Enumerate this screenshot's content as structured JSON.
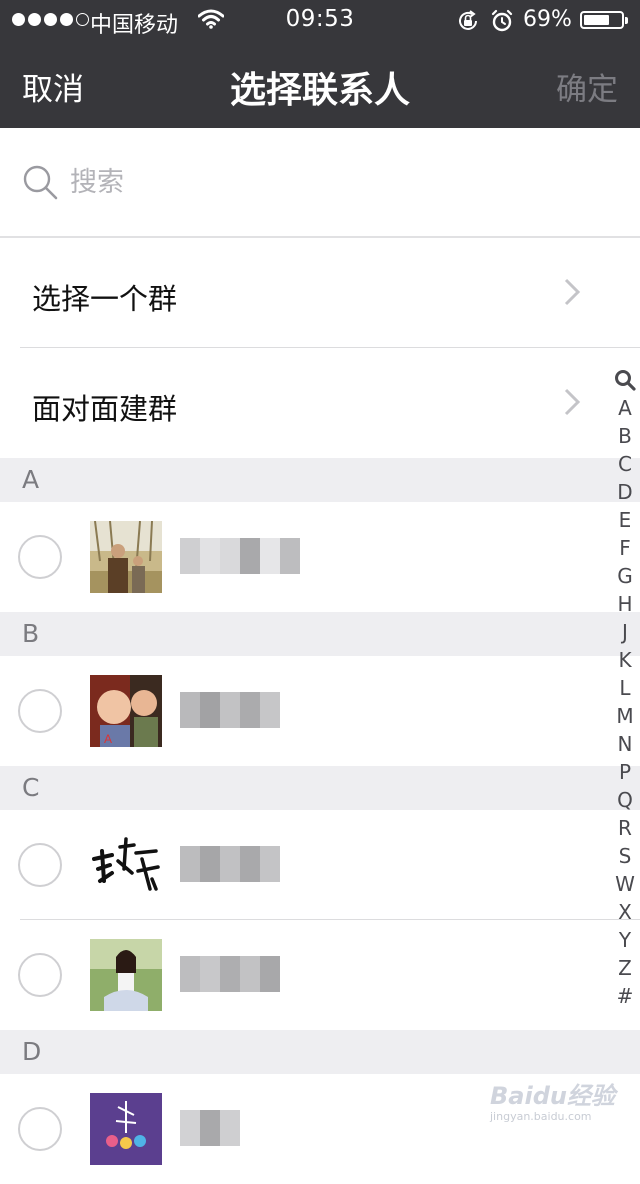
{
  "status_bar": {
    "carrier": "中国移动",
    "time": "09:53",
    "battery_percent": "69%",
    "battery_level": 0.69,
    "signal_bars_filled": 4,
    "signal_bars_total": 5
  },
  "nav": {
    "cancel_label": "取消",
    "title": "选择联系人",
    "confirm_label": "确定"
  },
  "search": {
    "placeholder": "搜索",
    "value": ""
  },
  "menu": {
    "select_group_label": "选择一个群",
    "face_to_face_label": "面对面建群"
  },
  "sections": [
    {
      "letter": "A"
    },
    {
      "letter": "B"
    },
    {
      "letter": "C"
    },
    {
      "letter": "D"
    }
  ],
  "index_bar": [
    "A",
    "B",
    "C",
    "D",
    "E",
    "F",
    "G",
    "H",
    "J",
    "K",
    "L",
    "M",
    "N",
    "P",
    "Q",
    "R",
    "S",
    "W",
    "X",
    "Y",
    "Z",
    "#"
  ],
  "watermark": {
    "brand": "Baidu经验",
    "url": "jingyan.baidu.com"
  },
  "colors": {
    "header_bg": "#37373b",
    "section_bg": "#eeeef1",
    "divider": "#dcdcde",
    "confirm_disabled": "#7c7c82"
  }
}
